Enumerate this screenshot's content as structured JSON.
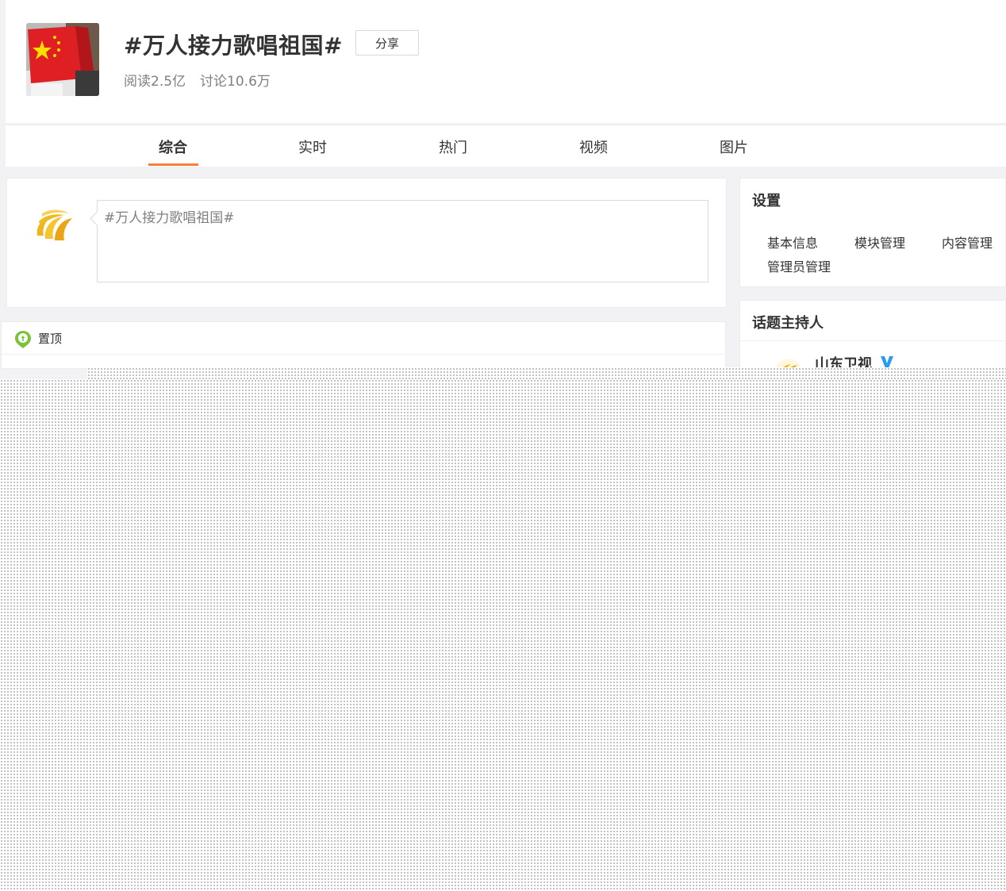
{
  "topic": {
    "title": "#万人接力歌唱祖国#",
    "share_label": "分享",
    "reads": "阅读2.5亿",
    "discussions": "讨论10.6万"
  },
  "tabs": [
    {
      "label": "综合",
      "active": true
    },
    {
      "label": "实时",
      "active": false
    },
    {
      "label": "热门",
      "active": false
    },
    {
      "label": "视频",
      "active": false
    },
    {
      "label": "图片",
      "active": false
    }
  ],
  "composer": {
    "text": "#万人接力歌唱祖国#"
  },
  "pinned": {
    "label": "置顶"
  },
  "settings": {
    "title": "设置",
    "links": [
      "基本信息",
      "模块管理",
      "内容管理",
      "管理员管理"
    ]
  },
  "host": {
    "title": "话题主持人",
    "name": "山东卫视",
    "verified": true
  },
  "colors": {
    "accent": "#fa7d3c",
    "verified": "#2b9bef",
    "pin_green": "#7cc23a",
    "logo_gold": "#f0b51a"
  }
}
